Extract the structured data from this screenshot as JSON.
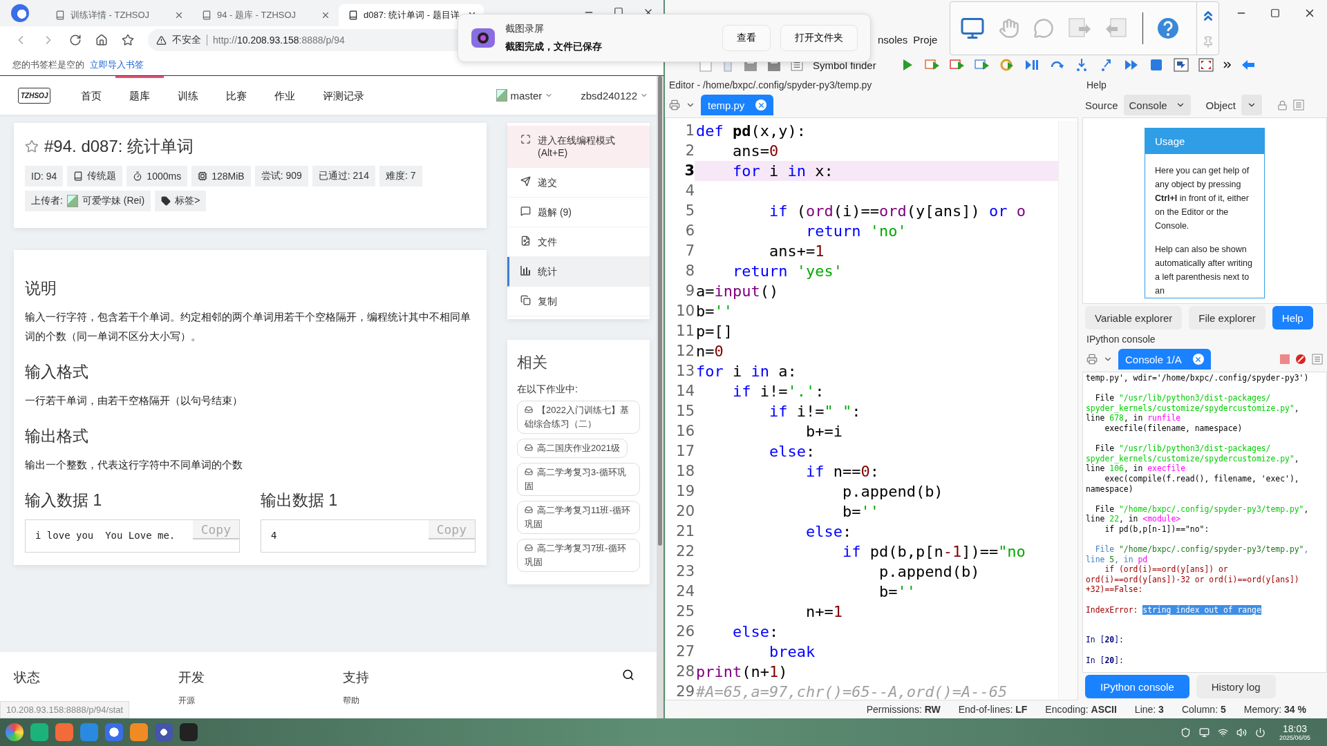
{
  "browser": {
    "tabs": [
      {
        "title": "训练详情 - TZHSOJ",
        "selected": false
      },
      {
        "title": "94 - 题库 - TZHSOJ",
        "selected": false
      },
      {
        "title": "d087: 统计单词 - 题目详",
        "selected": true
      }
    ],
    "security": "不安全",
    "url": "http://**10.208.93.158**:8888/p/94",
    "bookmarks": {
      "message": "您的书签栏是空的",
      "link": "立即导入书签"
    }
  },
  "site": {
    "logo": "TZHSOJ",
    "nav": [
      {
        "label": "首页",
        "selected": false
      },
      {
        "label": "题库",
        "selected": true
      },
      {
        "label": "训练",
        "selected": false
      },
      {
        "label": "比赛",
        "selected": false
      },
      {
        "label": "作业",
        "selected": false
      },
      {
        "label": "评测记录",
        "selected": false
      }
    ],
    "user_menus": [
      "master",
      "zbsd240122"
    ],
    "problem": {
      "title": "#94. d087: 统计单词",
      "starred": false,
      "badges": [
        {
          "kind": "plain",
          "text": "ID: 94"
        },
        {
          "kind": "type",
          "text": "传统题"
        },
        {
          "kind": "time",
          "text": "1000ms"
        },
        {
          "kind": "memory",
          "text": "128MiB"
        },
        {
          "kind": "plain",
          "text": "尝试: 909"
        },
        {
          "kind": "plain",
          "text": "已通过: 214"
        },
        {
          "kind": "plain",
          "text": "难度: 7"
        }
      ],
      "uploader_label": "上传者:",
      "uploader": "可爱学妹 (Rei)",
      "tags_label": "标签>"
    },
    "sections": [
      {
        "heading": "说明",
        "body": "输入一行字符，包含若干个单词。约定相邻的两个单词用若干个空格隔开，编程统计其中不相同单词的个数（同一单词不区分大小写）。"
      },
      {
        "heading": "输入格式",
        "body": "一行若干单词，由若干空格隔开（以句号结束）"
      },
      {
        "heading": "输出格式",
        "body": "输出一个整数，代表这行字符中不同单词的个数"
      }
    ],
    "samples": [
      {
        "heading": "输入数据 1",
        "content": "i love you  You Love me.",
        "copy": "Copy"
      },
      {
        "heading": "输出数据 1",
        "content": "4",
        "copy": "Copy"
      }
    ],
    "sidebar": [
      {
        "kind": "fullscreen",
        "label": "进入在线编程模式",
        "hint": "(Alt+E)",
        "selected": false,
        "highlighted": true
      },
      {
        "kind": "send",
        "label": "递交",
        "selected": false,
        "highlighted": false
      },
      {
        "kind": "comment",
        "label": "题解 (9)",
        "selected": false,
        "highlighted": false
      },
      {
        "kind": "file",
        "label": "文件",
        "selected": false,
        "highlighted": false
      },
      {
        "kind": "stats",
        "label": "统计",
        "selected": true,
        "highlighted": false
      },
      {
        "kind": "copy",
        "label": "复制",
        "selected": false,
        "highlighted": false
      }
    ],
    "related": {
      "title": "相关",
      "subtitle": "在以下作业中:",
      "items": [
        "【2022入门训练七】基础综合练习（二）",
        "高二国庆作业2021级",
        "高二学考复习3-循环巩固",
        "高二学考复习11班-循环巩固",
        "高二学考复习7班-循环巩固"
      ]
    },
    "footer": [
      {
        "heading": "状态"
      },
      {
        "heading": "开发",
        "links": [
          "开源"
        ]
      },
      {
        "heading": "支持",
        "links": [
          "帮助"
        ]
      }
    ],
    "status_url": "10.208.93.158:8888/p/94/stat"
  },
  "notification": {
    "app": "截图录屏",
    "message": "截图完成，文件已保存",
    "buttons": [
      "查看",
      "打开文件夹"
    ]
  },
  "spyder": {
    "menu": [
      "nsoles",
      "Proje"
    ],
    "toolbar_label": "Symbol finder",
    "editor": {
      "header": "Editor - /home/bxpc/.config/spyder-py3/temp.py",
      "tabs": [
        {
          "label": "temp.py",
          "selected": true
        }
      ],
      "lines": [
        {
          "number": "1",
          "current": false,
          "tokens": [
            {
              "kind": "k",
              "text": "def "
            },
            {
              "kind": "d",
              "text": "pd"
            },
            {
              "kind": "p",
              "text": "(x,y):"
            }
          ]
        },
        {
          "number": "2",
          "current": false,
          "tokens": [
            {
              "kind": "p",
              "text": "    ans="
            },
            {
              "kind": "n",
              "text": "0"
            }
          ]
        },
        {
          "number": "3",
          "current": true,
          "tokens": [
            {
              "kind": "k",
              "text": "    for"
            },
            {
              "kind": "p",
              "text": " i "
            },
            {
              "kind": "k",
              "text": "in"
            },
            {
              "kind": "p",
              "text": " x:"
            }
          ]
        },
        {
          "number": "4",
          "current": false
        },
        {
          "number": "5",
          "current": false,
          "tokens": [
            {
              "kind": "k",
              "text": "        if"
            },
            {
              "kind": "p",
              "text": " ("
            },
            {
              "kind": "b",
              "text": "ord"
            },
            {
              "kind": "p",
              "text": "(i)=="
            },
            {
              "kind": "b",
              "text": "ord"
            },
            {
              "kind": "p",
              "text": "(y[ans]) "
            },
            {
              "kind": "k",
              "text": "or"
            },
            {
              "kind": "b",
              "text": " o"
            }
          ]
        },
        {
          "number": "6",
          "current": false,
          "tokens": [
            {
              "kind": "k",
              "text": "            return"
            },
            {
              "kind": "s",
              "text": " 'no'"
            }
          ]
        },
        {
          "number": "7",
          "current": false,
          "tokens": [
            {
              "kind": "p",
              "text": "        ans+="
            },
            {
              "kind": "n",
              "text": "1"
            }
          ]
        },
        {
          "number": "8",
          "current": false,
          "tokens": [
            {
              "kind": "k",
              "text": "    return"
            },
            {
              "kind": "s",
              "text": " 'yes'"
            }
          ]
        },
        {
          "number": "9",
          "current": false,
          "tokens": [
            {
              "kind": "p",
              "text": "a="
            },
            {
              "kind": "b",
              "text": "input"
            },
            {
              "kind": "p",
              "text": "()"
            }
          ]
        },
        {
          "number": "10",
          "current": false,
          "tokens": [
            {
              "kind": "p",
              "text": "b="
            },
            {
              "kind": "s",
              "text": "''"
            }
          ]
        },
        {
          "number": "11",
          "current": false,
          "tokens": [
            {
              "kind": "p",
              "text": "p=[]"
            }
          ]
        },
        {
          "number": "12",
          "current": false,
          "tokens": [
            {
              "kind": "p",
              "text": "n="
            },
            {
              "kind": "n",
              "text": "0"
            }
          ]
        },
        {
          "number": "13",
          "current": false,
          "tokens": [
            {
              "kind": "k",
              "text": "for"
            },
            {
              "kind": "p",
              "text": " i "
            },
            {
              "kind": "k",
              "text": "in"
            },
            {
              "kind": "p",
              "text": " a:"
            }
          ]
        },
        {
          "number": "14",
          "current": false,
          "tokens": [
            {
              "kind": "k",
              "text": "    if"
            },
            {
              "kind": "p",
              "text": " i!="
            },
            {
              "kind": "s",
              "text": "'.'"
            },
            {
              "kind": "p",
              "text": ":"
            }
          ]
        },
        {
          "number": "15",
          "current": false,
          "tokens": [
            {
              "kind": "k",
              "text": "        if"
            },
            {
              "kind": "p",
              "text": " i!="
            },
            {
              "kind": "s",
              "text": "\" \""
            },
            {
              "kind": "p",
              "text": ":"
            }
          ]
        },
        {
          "number": "16",
          "current": false,
          "tokens": [
            {
              "kind": "p",
              "text": "            b+=i"
            }
          ]
        },
        {
          "number": "17",
          "current": false,
          "tokens": [
            {
              "kind": "k",
              "text": "        else"
            },
            {
              "kind": "p",
              "text": ":"
            }
          ]
        },
        {
          "number": "18",
          "current": false,
          "tokens": [
            {
              "kind": "k",
              "text": "            if"
            },
            {
              "kind": "p",
              "text": " n=="
            },
            {
              "kind": "n",
              "text": "0"
            },
            {
              "kind": "p",
              "text": ":"
            }
          ]
        },
        {
          "number": "19",
          "current": false,
          "tokens": [
            {
              "kind": "p",
              "text": "                p.append(b)"
            }
          ]
        },
        {
          "number": "20",
          "current": false,
          "tokens": [
            {
              "kind": "p",
              "text": "                b="
            },
            {
              "kind": "s",
              "text": "''"
            }
          ]
        },
        {
          "number": "21",
          "current": false,
          "tokens": [
            {
              "kind": "k",
              "text": "            else"
            },
            {
              "kind": "p",
              "text": ":"
            }
          ]
        },
        {
          "number": "22",
          "current": false,
          "tokens": [
            {
              "kind": "k",
              "text": "                if"
            },
            {
              "kind": "p",
              "text": " pd(b,p[n"
            },
            {
              "kind": "n",
              "text": "-1"
            },
            {
              "kind": "p",
              "text": "])=="
            },
            {
              "kind": "s",
              "text": "\"no"
            }
          ]
        },
        {
          "number": "23",
          "current": false,
          "tokens": [
            {
              "kind": "p",
              "text": "                    p.append(b)"
            }
          ]
        },
        {
          "number": "24",
          "current": false,
          "tokens": [
            {
              "kind": "p",
              "text": "                    b="
            },
            {
              "kind": "s",
              "text": "''"
            }
          ]
        },
        {
          "number": "25",
          "current": false,
          "tokens": [
            {
              "kind": "p",
              "text": "            n+="
            },
            {
              "kind": "n",
              "text": "1"
            }
          ]
        },
        {
          "number": "26",
          "current": false,
          "tokens": [
            {
              "kind": "k",
              "text": "    else"
            },
            {
              "kind": "p",
              "text": ":"
            }
          ]
        },
        {
          "number": "27",
          "current": false,
          "tokens": [
            {
              "kind": "k",
              "text": "        break"
            }
          ]
        },
        {
          "number": "28",
          "current": false,
          "tokens": [
            {
              "kind": "b",
              "text": "print"
            },
            {
              "kind": "p",
              "text": "(n+"
            },
            {
              "kind": "n",
              "text": "1"
            },
            {
              "kind": "p",
              "text": ")"
            }
          ]
        },
        {
          "number": "29",
          "current": false,
          "tokens": [
            {
              "kind": "c",
              "text": "#A=65,a=97,chr()=65--A,ord()=A--65"
            }
          ]
        }
      ]
    },
    "help": {
      "title": "Help",
      "source_label": "Source",
      "source_value": "Console",
      "object_label": "Object",
      "usage_title": "Usage",
      "usage_paragraphs": [
        "Here you can get help of any object by pressing **Ctrl+I** in front of it, either on the Editor or the Console.",
        "Help can also be shown automatically after writing a left parenthesis next to an"
      ],
      "tabs": [
        {
          "label": "Variable explorer",
          "selected": false
        },
        {
          "label": "File explorer",
          "selected": false
        },
        {
          "label": "Help",
          "selected": true
        }
      ]
    },
    "console": {
      "title": "IPython console",
      "tabs": [
        {
          "label": "Console 1/A",
          "selected": true
        }
      ],
      "lines": [
        {
          "tokens": [
            {
              "kind": "p",
              "text": "temp.py', wdir='/home/bxpc/.config/spyder-py3')"
            }
          ]
        },
        {
          "blank": true
        },
        {
          "tokens": [
            {
              "kind": "p",
              "text": "  File "
            },
            {
              "kind": "g",
              "text": "\"/usr/lib/python3/dist-packages/"
            }
          ]
        },
        {
          "tokens": [
            {
              "kind": "g",
              "text": "spyder_kernels/customize/spydercustomize.py\""
            },
            {
              "kind": "p",
              "text": ","
            }
          ]
        },
        {
          "tokens": [
            {
              "kind": "p",
              "text": "line "
            },
            {
              "kind": "g",
              "text": "678"
            },
            {
              "kind": "p",
              "text": ", in "
            },
            {
              "kind": "m",
              "text": "runfile"
            }
          ]
        },
        {
          "tokens": [
            {
              "kind": "p",
              "text": "    execfile(filename, namespace)"
            }
          ]
        },
        {
          "blank": true
        },
        {
          "tokens": [
            {
              "kind": "p",
              "text": "  File "
            },
            {
              "kind": "g",
              "text": "\"/usr/lib/python3/dist-packages/"
            }
          ]
        },
        {
          "tokens": [
            {
              "kind": "g",
              "text": "spyder_kernels/customize/spydercustomize.py\""
            },
            {
              "kind": "p",
              "text": ","
            }
          ]
        },
        {
          "tokens": [
            {
              "kind": "p",
              "text": "line "
            },
            {
              "kind": "g",
              "text": "106"
            },
            {
              "kind": "p",
              "text": ", in "
            },
            {
              "kind": "m",
              "text": "execfile"
            }
          ]
        },
        {
          "tokens": [
            {
              "kind": "p",
              "text": "    exec(compile(f.read(), filename, 'exec'),"
            }
          ]
        },
        {
          "tokens": [
            {
              "kind": "p",
              "text": "namespace)"
            }
          ]
        },
        {
          "blank": true
        },
        {
          "tokens": [
            {
              "kind": "p",
              "text": "  File "
            },
            {
              "kind": "g",
              "text": "\"/home/bxpc/.config/spyder-py3/temp.py\""
            },
            {
              "kind": "p",
              "text": ","
            }
          ]
        },
        {
          "tokens": [
            {
              "kind": "p",
              "text": "line "
            },
            {
              "kind": "g",
              "text": "22"
            },
            {
              "kind": "p",
              "text": ", in "
            },
            {
              "kind": "m",
              "text": "<module>"
            }
          ]
        },
        {
          "tokens": [
            {
              "kind": "p",
              "text": "    if pd(b,p[n-1])==\"no\":"
            }
          ]
        },
        {
          "blank": true
        },
        {
          "tokens": [
            {
              "kind": "u",
              "text": "  File "
            },
            {
              "kind": "dg",
              "text": "\"/home/bxpc/.config/spyder-py3/temp.py\""
            },
            {
              "kind": "u",
              "text": ","
            }
          ]
        },
        {
          "tokens": [
            {
              "kind": "u",
              "text": "line "
            },
            {
              "kind": "dg",
              "text": "5"
            },
            {
              "kind": "u",
              "text": ", in "
            },
            {
              "kind": "m",
              "text": "pd"
            }
          ]
        },
        {
          "tokens": [
            {
              "kind": "r",
              "text": "    if (ord(i)==ord(y[ans]) or"
            }
          ]
        },
        {
          "tokens": [
            {
              "kind": "r",
              "text": "ord(i)==ord(y[ans])-32 or ord(i)==ord(y[ans])"
            }
          ]
        },
        {
          "tokens": [
            {
              "kind": "r",
              "text": "+32)==False:"
            }
          ]
        },
        {
          "blank": true
        },
        {
          "tokens": [
            {
              "kind": "r",
              "text": "IndexError: "
            },
            {
              "kind": "sel",
              "text": "string index out of range"
            }
          ]
        },
        {
          "blank": true
        },
        {
          "blank": true
        },
        {
          "tokens": [
            {
              "kind": "q",
              "text": "In ["
            },
            {
              "kind": "qb",
              "text": "20"
            },
            {
              "kind": "q",
              "text": "]:"
            }
          ]
        },
        {
          "blank": true
        },
        {
          "tokens": [
            {
              "kind": "q",
              "text": "In ["
            },
            {
              "kind": "qb",
              "text": "20"
            },
            {
              "kind": "q",
              "text": "]:"
            }
          ]
        }
      ],
      "bottom_tabs": [
        {
          "label": "IPython console",
          "selected": true
        },
        {
          "label": "History log",
          "selected": false
        }
      ]
    },
    "status": [
      {
        "label": "Permissions:",
        "value": "RW"
      },
      {
        "label": "End-of-lines:",
        "value": "LF"
      },
      {
        "label": "Encoding:",
        "value": "ASCII"
      },
      {
        "label": "Line:",
        "value": "3"
      },
      {
        "label": "Column:",
        "value": "5"
      },
      {
        "label": "Memory:",
        "value": "34 %"
      }
    ]
  },
  "taskbar": {
    "time": "18:03",
    "date": "2025/06/05"
  }
}
